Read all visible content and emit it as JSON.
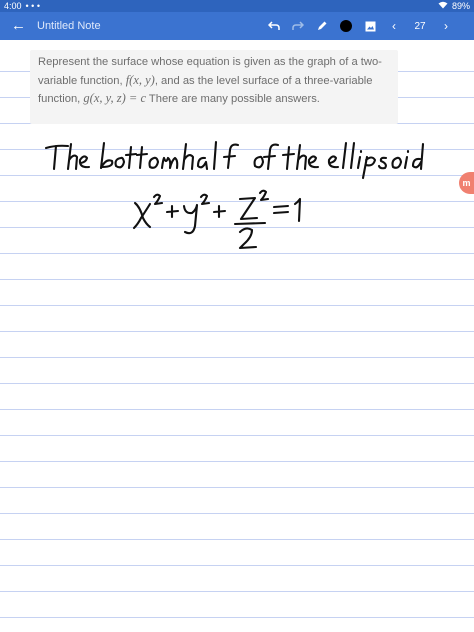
{
  "status": {
    "time": "4:00",
    "left_dots": "• • •",
    "battery": "89%"
  },
  "header": {
    "back_icon": "arrow-left-icon",
    "title": "Untitled Note",
    "undo_icon": "undo-icon",
    "redo_icon": "redo-icon",
    "pen_icon": "pen-icon",
    "image_icon": "image-icon",
    "prev_icon": "chevron-left-icon",
    "page_number": "27",
    "next_icon": "chevron-right-icon",
    "pen_color": "#000000",
    "accent": "#3b73d0"
  },
  "question": {
    "t1": "Represent the surface whose equation is given as the graph of a two-variable function, ",
    "m1": "f(x, y)",
    "t2": ", and as the level surface of a three-variable function, ",
    "m2": "g(x, y, z) = c",
    "t3": " There are many possible answers."
  },
  "handwriting": {
    "line1": "The bottom half of the ellipsoid",
    "equation": "x² + y² + z²/2 = 1"
  }
}
